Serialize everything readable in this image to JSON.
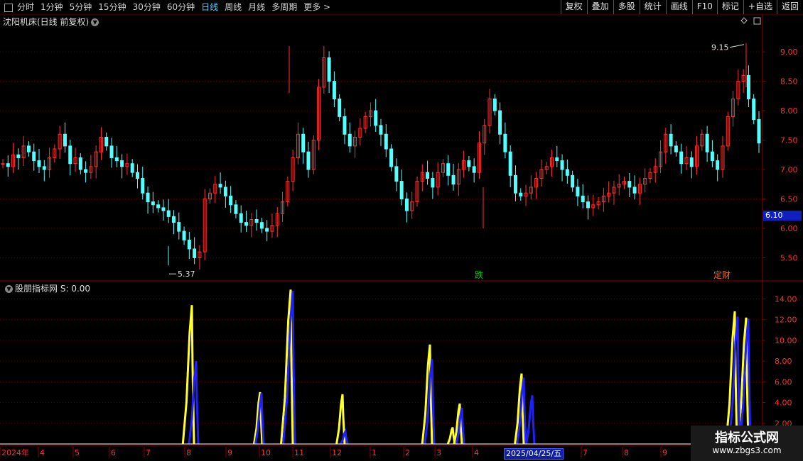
{
  "toolbar": {
    "periods": [
      "分时",
      "1分钟",
      "5分钟",
      "15分钟",
      "30分钟",
      "60分钟",
      "日线",
      "周线",
      "月线",
      "多周期",
      "更多 >"
    ],
    "active": "日线",
    "buttons": [
      "复权",
      "叠加",
      "多股",
      "统计",
      "画线",
      "F10",
      "标记",
      "+自选",
      "返回"
    ]
  },
  "main_panel": {
    "title": "沈阳机床(日线 前复权)",
    "high_label": "9.15",
    "low_label": "5.37",
    "current_price": "6.10",
    "markers": [
      {
        "text": "跌",
        "color": "#00d000"
      },
      {
        "text": "定财",
        "color": "#ff6a20"
      }
    ]
  },
  "sub_panel": {
    "title": "股朋指标网",
    "value_label": "S: 0.00"
  },
  "watermark": {
    "line1": "指标公式网",
    "line2": "www.zbgs3.com"
  },
  "chart_data": [
    {
      "type": "candlestick",
      "title": "沈阳机床(日线 前复权)",
      "y_ticks": [
        "5.50",
        "6.00",
        "6.50",
        "7.00",
        "7.50",
        "8.00",
        "8.50",
        "9.00"
      ],
      "ylim": [
        5.3,
        9.4
      ],
      "up_color": "#ff3030",
      "down_color": "#54ffff",
      "closes": [
        7.1,
        7.05,
        7.25,
        7.2,
        7.4,
        7.3,
        7.15,
        7.05,
        7.0,
        7.2,
        7.35,
        7.6,
        7.4,
        7.1,
        7.2,
        7.0,
        6.95,
        7.05,
        7.3,
        7.55,
        7.4,
        7.2,
        7.15,
        7.05,
        7.1,
        6.95,
        6.85,
        6.6,
        6.45,
        6.4,
        6.35,
        6.3,
        6.2,
        6.1,
        5.95,
        5.8,
        5.65,
        5.5,
        5.6,
        6.5,
        6.6,
        6.75,
        6.7,
        6.55,
        6.4,
        6.25,
        6.1,
        6.05,
        6.15,
        6.1,
        6.0,
        5.95,
        6.05,
        6.25,
        6.45,
        6.8,
        7.2,
        7.6,
        7.3,
        7.0,
        7.5,
        8.4,
        8.9,
        8.5,
        8.2,
        7.9,
        7.6,
        7.4,
        7.55,
        7.7,
        7.9,
        8.0,
        7.75,
        7.6,
        7.35,
        7.05,
        6.8,
        6.5,
        6.3,
        6.45,
        6.8,
        6.95,
        6.85,
        6.7,
        6.95,
        7.1,
        6.9,
        6.75,
        7.0,
        7.15,
        7.05,
        6.95,
        7.45,
        7.75,
        8.2,
        8.0,
        7.6,
        7.3,
        6.9,
        6.6,
        6.55,
        6.6,
        6.7,
        6.85,
        7.0,
        7.05,
        7.2,
        7.15,
        7.0,
        6.9,
        6.7,
        6.55,
        6.45,
        6.35,
        6.4,
        6.45,
        6.55,
        6.6,
        6.7,
        6.75,
        6.8,
        6.7,
        6.6,
        6.75,
        6.85,
        6.95,
        7.05,
        7.3,
        7.6,
        7.4,
        7.3,
        7.1,
        7.2,
        7.05,
        7.4,
        7.6,
        7.3,
        7.15,
        7.0,
        7.4,
        7.9,
        8.2,
        8.5,
        8.6,
        8.2,
        7.85,
        7.45
      ],
      "high": 9.15,
      "low": 5.37
    },
    {
      "type": "line",
      "title": "股朋指标网",
      "y_ticks": [
        "2.00",
        "4.00",
        "6.00",
        "8.00",
        "10.00",
        "12.00",
        "14.00"
      ],
      "ylim": [
        0,
        15.2
      ],
      "series": [
        {
          "color": "#ffff30",
          "peaks": [
            [
              270,
              13.4
            ],
            [
              366,
              5.0
            ],
            [
              409,
              14.9
            ],
            [
              482,
              4.8
            ],
            [
              605,
              9.6
            ],
            [
              637,
              1.6
            ],
            [
              647,
              3.9
            ],
            [
              734,
              6.8
            ],
            [
              1034,
              12.8
            ],
            [
              1050,
              12.2
            ]
          ]
        },
        {
          "color": "#2020ff",
          "peaks": [
            [
              276,
              8.0
            ],
            [
              368,
              4.9
            ],
            [
              412,
              14.8
            ],
            [
              486,
              1.2
            ],
            [
              608,
              8.2
            ],
            [
              650,
              3.5
            ],
            [
              737,
              6.4
            ],
            [
              749,
              4.7
            ],
            [
              1038,
              12.3
            ],
            [
              1053,
              12.1
            ]
          ]
        }
      ]
    }
  ],
  "x_axis": {
    "labels": [
      "2024年",
      "4",
      "5",
      "6",
      "7",
      "8",
      "9",
      "10",
      "11",
      "12",
      "1",
      "2",
      "3",
      "4",
      "2025/04/25/五",
      "7",
      "8",
      "9"
    ]
  }
}
